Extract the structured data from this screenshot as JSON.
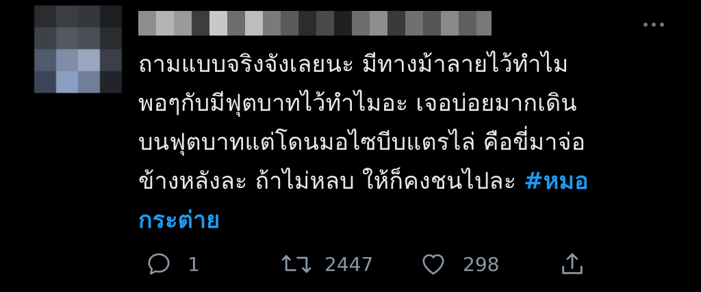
{
  "tweet": {
    "text_lines": [
      "ถามแบบจริงจังเลยนะ มีทางม้าลายไว้ทำไม",
      "พอๆกับมีฟุตบาทไว้ทำไมอะ เจอบ่อยมากเดิน",
      "บนฟุตบาทแต่โดนมอไซบีบแตรไล่ คือขี่มาจ่อ",
      "ข้างหลังละ ถ้าไม่หลบ ให้ก็คงชนไปละ"
    ],
    "hashtag_part1": "#หมอ",
    "hashtag_part2": "กระต่าย"
  },
  "actions": {
    "reply_count": "1",
    "retweet_count": "2447",
    "like_count": "298"
  },
  "colors": {
    "background": "#000000",
    "text": "#e7e9ea",
    "hashtag": "#1d9bf0",
    "muted": "#8b98a5"
  },
  "icons": [
    "more-icon",
    "reply-icon",
    "retweet-icon",
    "like-icon",
    "share-icon"
  ]
}
